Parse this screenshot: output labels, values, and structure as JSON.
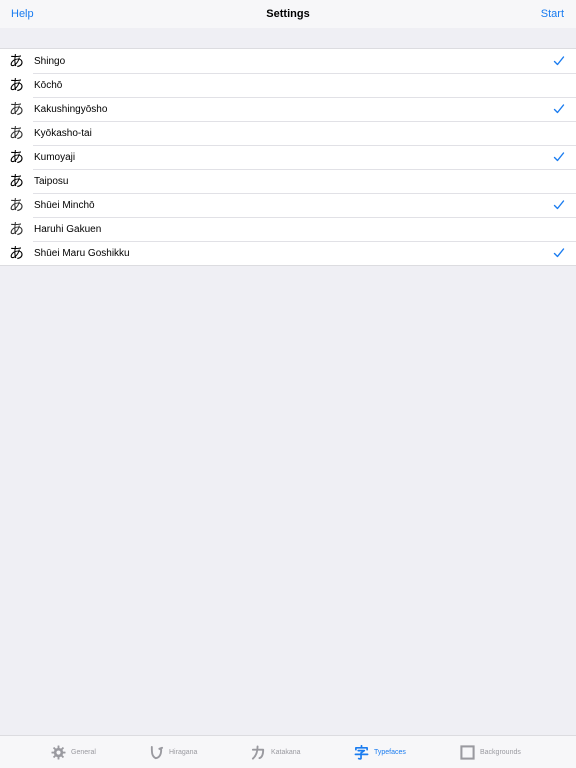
{
  "navbar": {
    "left_label": "Help",
    "title": "Settings",
    "right_label": "Start"
  },
  "typefaces": [
    {
      "glyph": "あ",
      "name": "Shingo",
      "checked": true
    },
    {
      "glyph": "あ",
      "name": "Kōchō",
      "checked": false
    },
    {
      "glyph": "あ",
      "name": "Kakushingyōsho",
      "checked": true
    },
    {
      "glyph": "あ",
      "name": "Kyōkasho-tai",
      "checked": false
    },
    {
      "glyph": "あ",
      "name": "Kumoyaji",
      "checked": true
    },
    {
      "glyph": "あ",
      "name": "Taiposu",
      "checked": false
    },
    {
      "glyph": "あ",
      "name": "Shūei Minchō",
      "checked": true
    },
    {
      "glyph": "あ",
      "name": "Haruhi Gakuen",
      "checked": false
    },
    {
      "glyph": "あ",
      "name": "Shūei Maru Goshikku",
      "checked": true
    }
  ],
  "tabbar": {
    "general": {
      "label": "General",
      "icon": "gear-icon"
    },
    "hiragana": {
      "label": "Hiragana",
      "icon": "hiragana-icon"
    },
    "katakana": {
      "label": "Katakana",
      "icon": "katakana-icon"
    },
    "typefaces": {
      "label": "Typefaces",
      "icon": "kanji-icon"
    },
    "backgrounds": {
      "label": "Backgrounds",
      "icon": "square-icon"
    },
    "active": "typefaces"
  },
  "colors": {
    "accent": "#1a7cf0",
    "inactive": "#9a9aa0",
    "background": "#efeff4"
  }
}
